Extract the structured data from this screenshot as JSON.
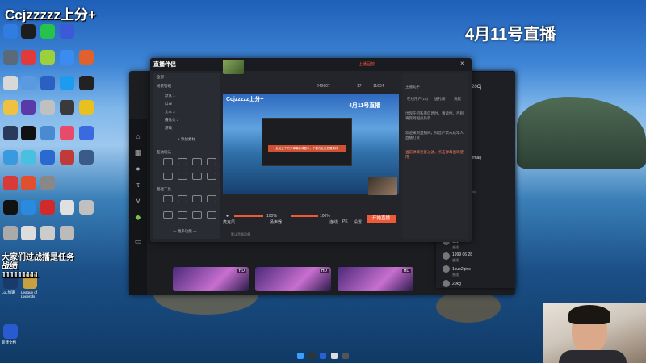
{
  "overlay": {
    "stream_title": "Ccjzzzzz上分+",
    "date_title": "4月11号直播",
    "task_line1": "大家们过战播是任务",
    "task_line2": "战绩",
    "task_line3": "111111111"
  },
  "obs_window": {
    "app_name": "直播伴侣",
    "record_label": "上播回放",
    "stat_likes": "249607",
    "stat_count1": "17",
    "stat_count2": "11694",
    "left_panel": {
      "tab_all": "全部",
      "tab_game": "游戏",
      "tab_voice": "互动",
      "scene_header": "场景管理",
      "scene_items": [
        "默认 1",
        "口罩",
        "文本 2",
        "摄像头 1",
        "游戏"
      ],
      "add_material": "+ 添加素材",
      "interact_header": "互动玩法",
      "basic_tools": "基础工具",
      "more_features": "— 更多功能 —"
    },
    "preview": {
      "title": "Ccjzzzzz上分+",
      "date": "4月11号直播",
      "notice": "此处正下方为弹幕区域显示，不要在此处放置素材"
    },
    "bottom_bar": {
      "mic_label": "麦克风",
      "mic_pct": "100%",
      "speaker_label": "扬声器",
      "speaker_pct": "100%",
      "tool1": "连线",
      "tool2": "PK",
      "tool3": "设置",
      "start_button": "开始直播"
    },
    "right_panel": {
      "tab1": "主播助手",
      "tab_online": "在线用户(18)",
      "tab_gift": "送礼榜",
      "tab_chat": "贡献",
      "msg1": "出现任何私密信息时，请遮挡，否则将受到相关处罚",
      "msg2": "欢迎来到直播间，抖音严禁未成年人直播打赏",
      "msg3": "当前弹幕重复过滤，点击弹幕出现使用"
    },
    "status_bar": "默认音频设备"
  },
  "chat_window": {
    "header": "20Cj",
    "users": [
      {
        "name": "Tactics (Normal)",
        "sub": "Tactics (Normal)"
      },
      {
        "name": "melevo",
        "sub": "Tactics (Normal)"
      },
      {
        "name": "111",
        "sub": "普通"
      },
      {
        "name": "1999 06 28",
        "sub": "普通"
      },
      {
        "name": "1cup2girls",
        "sub": "普通"
      },
      {
        "name": "20kg",
        "sub": "普通"
      }
    ]
  },
  "desktop": {
    "icon_labels": [
      "LoL加速",
      "League of Legends",
      "新建文档"
    ]
  },
  "colors": {
    "accent": "#ef5a36",
    "window_bg": "#23252b",
    "panel_bg": "#2a2c33"
  }
}
